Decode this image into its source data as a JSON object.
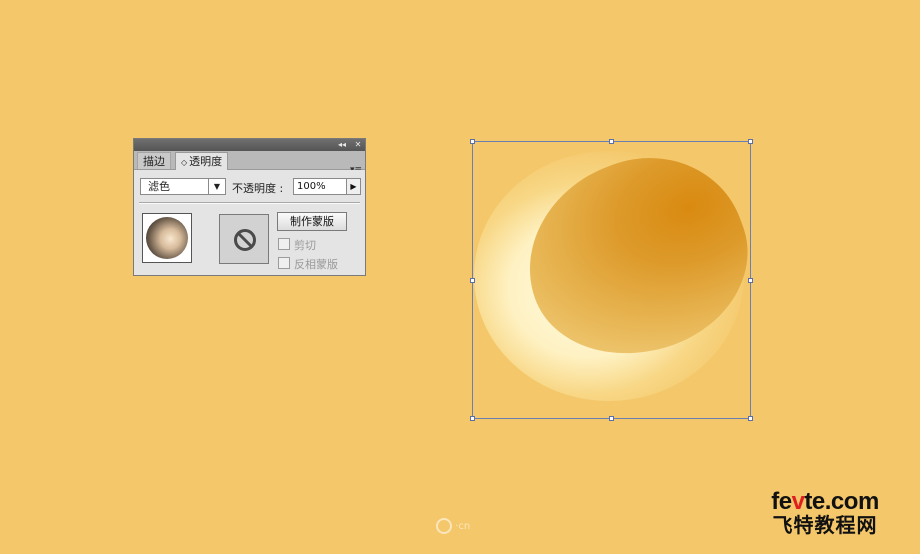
{
  "panel": {
    "tabs": [
      {
        "label": "描边"
      },
      {
        "label": "透明度",
        "active": true
      }
    ],
    "tab_arrow": "◇",
    "blend_mode": "滤色",
    "opacity_label": "不透明度 :",
    "opacity_value": "100%",
    "make_mask_label": "制作蒙版",
    "clip_label": "剪切",
    "invert_mask_label": "反相蒙版",
    "icons": {
      "collapse": "◂◂",
      "close": "✕",
      "menu": "▾≡",
      "dropdown": "▼",
      "stepper": "▶"
    }
  },
  "watermark": {
    "text": "·cn"
  },
  "site": {
    "url_pre": "fe",
    "url_v": "v",
    "url_post": "te.com",
    "name": "飞特教程网"
  },
  "colors": {
    "canvas": "#f4c76a",
    "egg_dark": "#d98a10",
    "egg_light": "#f3d487",
    "selection": "#6c7fb2",
    "site_accent": "#e02020"
  }
}
